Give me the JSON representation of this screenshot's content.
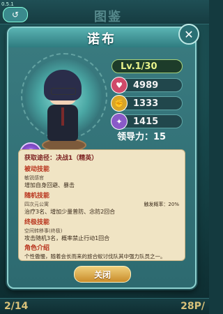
{
  "app": {
    "version": "0.5.1",
    "background_title": "图鉴",
    "background_page": "2/14",
    "background_right_text": "28P/"
  },
  "dialog": {
    "title": "诺布",
    "close_x": "✕",
    "close_button": "关闭",
    "badge": "S"
  },
  "stats": {
    "level": "Lv.1/30",
    "attack": "4989",
    "defense": "1333",
    "speed": "1415",
    "leadership": "领导力：15"
  },
  "info": {
    "source_label": "获取途径：决战1（精英）",
    "passive_label": "被动技能",
    "passive_name": "敏锐感官",
    "passive_desc": "增加自身回避、暴击",
    "random_label": "随机技能",
    "random_name": "四次元公寓",
    "random_rate": "触发概率：20%",
    "random_desc": "治疗3名、增加少量普防、念防2回合",
    "final_label": "终极技能",
    "final_name": "空间转移事(终极)",
    "final_desc": "攻击随机3名，概率禁止行动1回合",
    "intro_label": "角色介绍",
    "intro_desc": "个性傲慢，随着会长而来的旅合蚁讨伐队其中强力队员之一。"
  },
  "colors": {
    "dialog_bg": "#2d6a70",
    "info_bg": "#f0e4c4",
    "accent_red": "#b8321b",
    "button": "#d9a240"
  }
}
